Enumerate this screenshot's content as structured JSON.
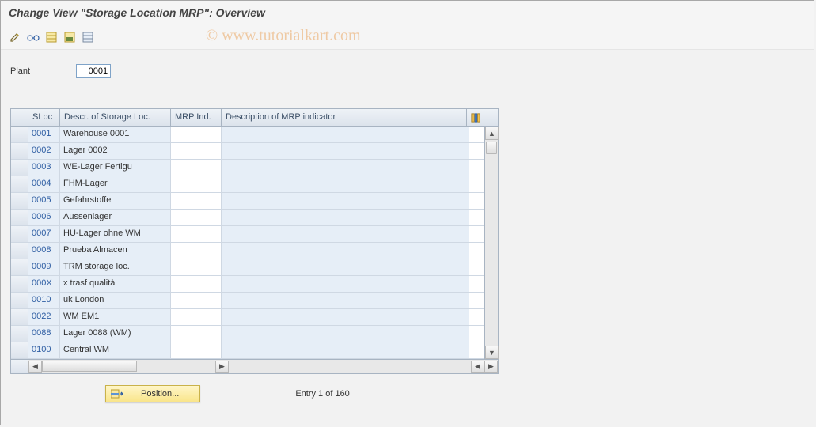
{
  "title": "Change View \"Storage Location MRP\": Overview",
  "watermark": "© www.tutorialkart.com",
  "toolbar": {
    "change": "change",
    "glasses": "display",
    "grid_h": "grid",
    "grid_save": "save",
    "grid_del": "delete"
  },
  "plant": {
    "label": "Plant",
    "value": "0001"
  },
  "table": {
    "headers": {
      "sloc": "SLoc",
      "desc": "Descr. of Storage Loc.",
      "mrp": "MRP Ind.",
      "mrpdesc": "Description of MRP indicator"
    },
    "rows": [
      {
        "sloc": "0001",
        "desc": "Warehouse 0001",
        "mrp": "",
        "mrpdesc": ""
      },
      {
        "sloc": "0002",
        "desc": "Lager 0002",
        "mrp": "",
        "mrpdesc": ""
      },
      {
        "sloc": "0003",
        "desc": "WE-Lager Fertigu",
        "mrp": "",
        "mrpdesc": ""
      },
      {
        "sloc": "0004",
        "desc": "FHM-Lager",
        "mrp": "",
        "mrpdesc": ""
      },
      {
        "sloc": "0005",
        "desc": "Gefahrstoffe",
        "mrp": "",
        "mrpdesc": ""
      },
      {
        "sloc": "0006",
        "desc": "Aussenlager",
        "mrp": "",
        "mrpdesc": ""
      },
      {
        "sloc": "0007",
        "desc": "HU-Lager ohne WM",
        "mrp": "",
        "mrpdesc": ""
      },
      {
        "sloc": "0008",
        "desc": "Prueba Almacen",
        "mrp": "",
        "mrpdesc": ""
      },
      {
        "sloc": "0009",
        "desc": "TRM storage loc.",
        "mrp": "",
        "mrpdesc": ""
      },
      {
        "sloc": "000X",
        "desc": "x trasf qualità",
        "mrp": "",
        "mrpdesc": ""
      },
      {
        "sloc": "0010",
        "desc": "uk London",
        "mrp": "",
        "mrpdesc": ""
      },
      {
        "sloc": "0022",
        "desc": "WM EM1",
        "mrp": "",
        "mrpdesc": ""
      },
      {
        "sloc": "0088",
        "desc": "Lager 0088 (WM)",
        "mrp": "",
        "mrpdesc": ""
      },
      {
        "sloc": "0100",
        "desc": "Central WM",
        "mrp": "",
        "mrpdesc": ""
      }
    ]
  },
  "footer": {
    "position_label": "Position...",
    "entry_text": "Entry 1 of 160"
  }
}
